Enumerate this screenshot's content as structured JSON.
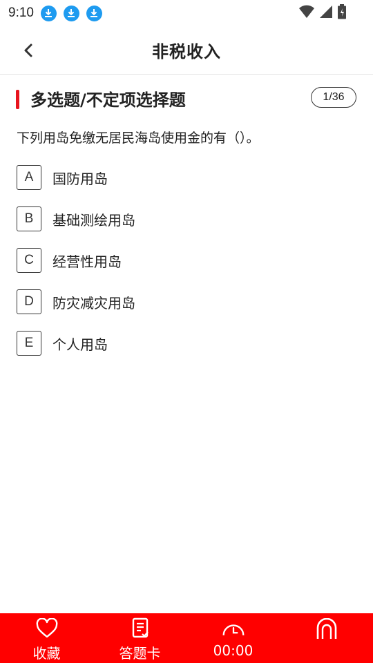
{
  "status": {
    "time": "9:10",
    "notification_icons": [
      "download-icon",
      "download-icon",
      "download-icon"
    ]
  },
  "header": {
    "title": "非税收入"
  },
  "question": {
    "type": "多选题/不定项选择题",
    "counter": "1/36",
    "text": "下列用岛免缴无居民海岛使用金的有（）。",
    "options": [
      {
        "letter": "A",
        "text": "国防用岛"
      },
      {
        "letter": "B",
        "text": "基础测绘用岛"
      },
      {
        "letter": "C",
        "text": "经营性用岛"
      },
      {
        "letter": "D",
        "text": "防灾减灾用岛"
      },
      {
        "letter": "E",
        "text": "个人用岛"
      }
    ]
  },
  "bottom_bar": {
    "color": "#ff0000",
    "tabs": [
      {
        "label": "收藏",
        "icon": "heart-icon"
      },
      {
        "label": "答题卡",
        "icon": "answer-card-icon"
      },
      {
        "label": "00:00",
        "icon": "timer-icon"
      },
      {
        "label": "",
        "icon": "submit-icon"
      }
    ]
  }
}
